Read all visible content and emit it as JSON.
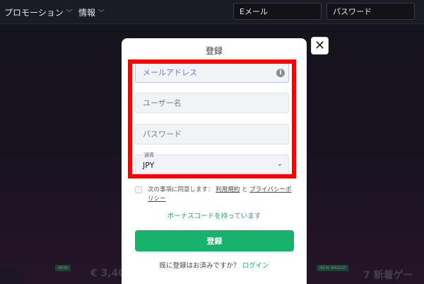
{
  "topbar": {
    "promotions_label": "プロモーション",
    "info_label": "情報",
    "email_placeholder": "Eメール",
    "password_placeholder": "パスワード"
  },
  "background": {
    "badge_left": "NEW",
    "amount_text": "€ 3,40",
    "badge_right": "NEW BADGE",
    "new_games_text": "7 新着ゲー"
  },
  "modal": {
    "title": "登録",
    "close_glyph": "✕",
    "email_placeholder": "メールアドレス",
    "info_glyph": "i",
    "username_placeholder": "ユーザー名",
    "password_placeholder": "パスワード",
    "currency_label": "通貨",
    "currency_value": "JPY",
    "currency_chevron": "⌄",
    "terms_prefix": "次の事項に同意します：",
    "terms_link": "利用規約",
    "terms_and": "と",
    "privacy_link": "プライバシーポリシー",
    "bonus_link": "ボーナスコードを持っています",
    "submit_label": "登録",
    "login_prompt": "既に登録はお済みですか？",
    "login_link": "ログイン"
  },
  "colors": {
    "accent_green": "#17b26c",
    "highlight_red": "#ff0000"
  }
}
